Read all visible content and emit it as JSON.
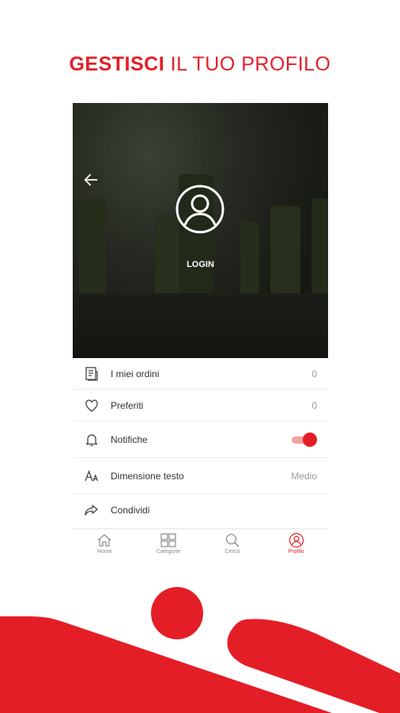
{
  "headline": {
    "bold": "GESTISCI",
    "light": " IL TUO PROFILO"
  },
  "colors": {
    "accent": "#e41e26"
  },
  "hero": {
    "login_label": "LOGIN",
    "back_icon": "arrow-left-icon",
    "avatar_icon": "user-circle-icon"
  },
  "menu": [
    {
      "icon": "receipt-icon",
      "label": "I miei ordini",
      "value": "0"
    },
    {
      "icon": "heart-icon",
      "label": "Preferiti",
      "value": "0"
    },
    {
      "icon": "bell-icon",
      "label": "Notifiche",
      "toggle_on": true
    },
    {
      "icon": "text-size-icon",
      "label": "Dimensione testo",
      "value": "Medio"
    },
    {
      "icon": "share-icon",
      "label": "Condividi"
    }
  ],
  "tabs": [
    {
      "icon": "home-icon",
      "label": "Home"
    },
    {
      "icon": "grid-icon",
      "label": "Categorie"
    },
    {
      "icon": "search-icon",
      "label": "Cerca"
    },
    {
      "icon": "profile-icon",
      "label": "Profilo",
      "active": true
    }
  ]
}
